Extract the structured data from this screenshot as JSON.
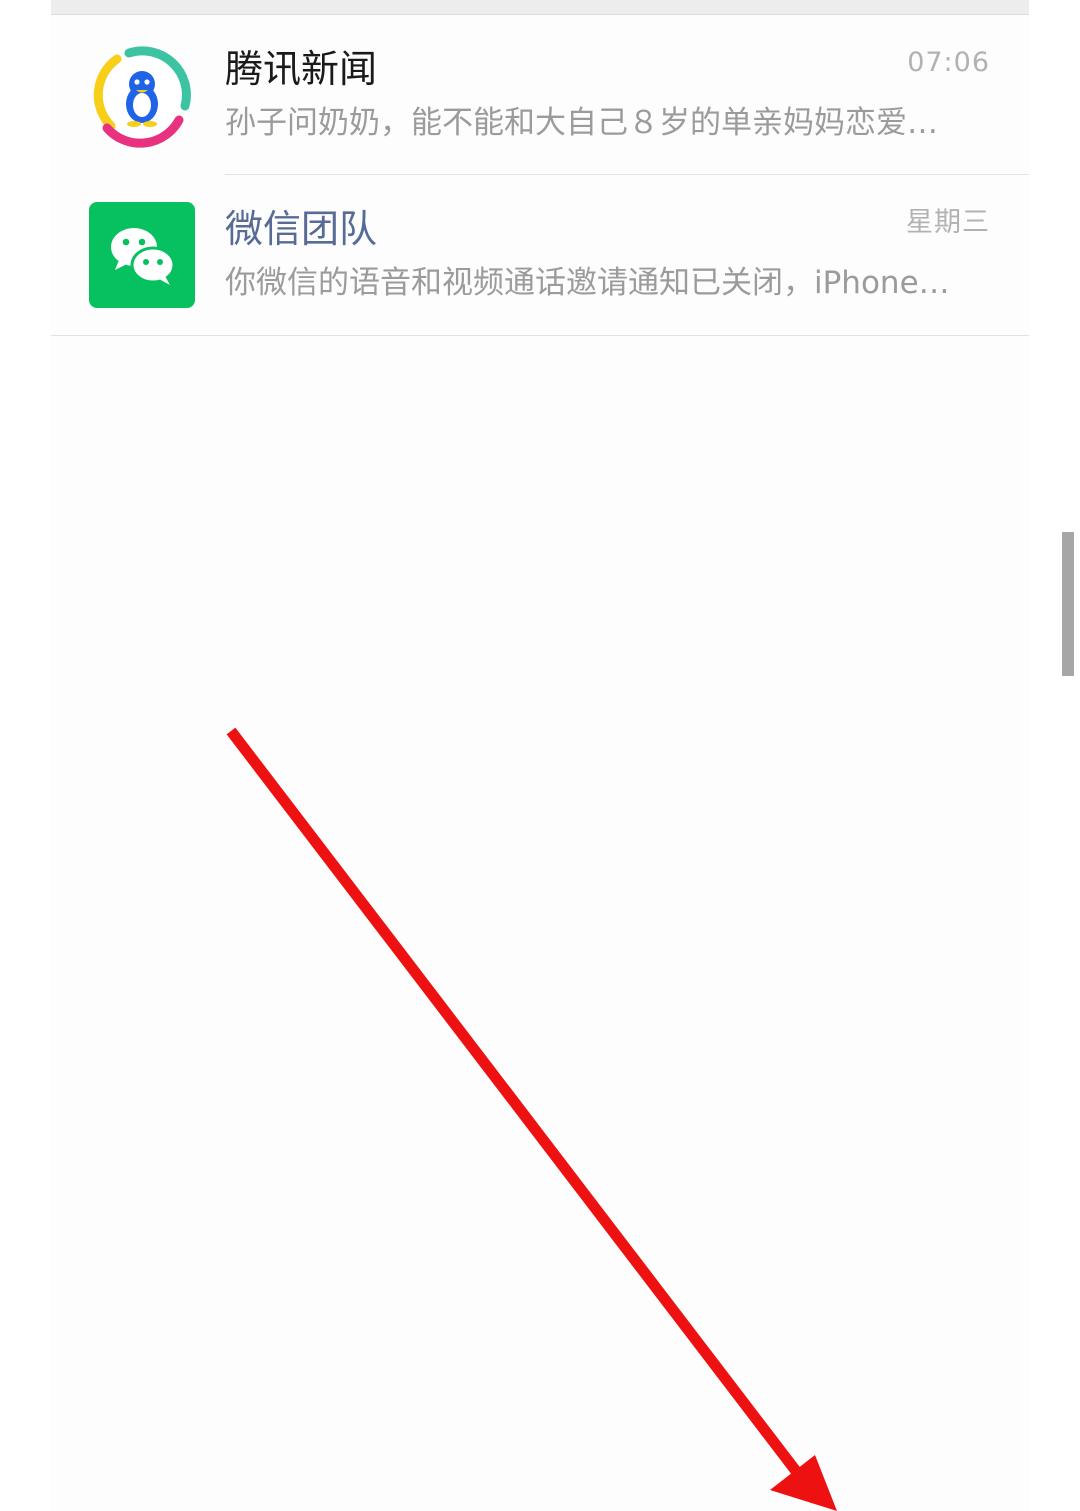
{
  "chats": [
    {
      "title": "腾讯新闻",
      "time": "07:06",
      "preview": "孙子问奶奶，能不能和大自己８岁的单亲妈妈恋爱，…",
      "avatar_icon": "tencent-news-penguin-icon"
    },
    {
      "title": "微信团队",
      "time": "星期三",
      "preview": "你微信的语音和视频通话邀请通知已关闭，iPhone…",
      "avatar_icon": "wechat-logo-icon"
    }
  ],
  "colors": {
    "wechat_green": "#07c160",
    "official_account_title": "#576b95",
    "annotation_arrow": "#ee1111"
  },
  "annotation": {
    "type": "arrow",
    "direction": "down-right"
  }
}
